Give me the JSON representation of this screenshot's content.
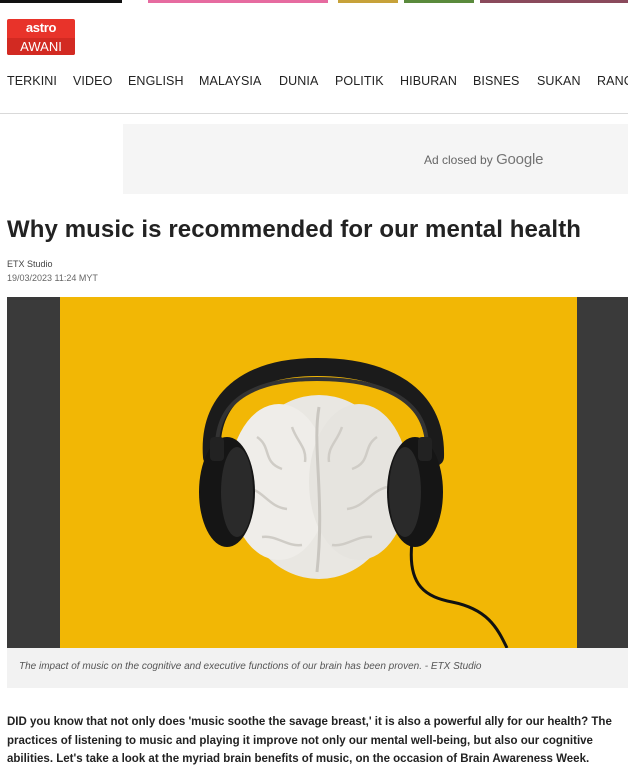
{
  "site": {
    "logo_top": "astro",
    "logo_bottom": "AWANI",
    "brand_color": "#e8332a"
  },
  "nav": {
    "items": [
      "TERKINI",
      "VIDEO",
      "ENGLISH",
      "MALAYSIA",
      "DUNIA",
      "POLITIK",
      "HIBURAN",
      "BISNES",
      "SUKAN",
      "RANC"
    ]
  },
  "ad": {
    "closed_text": "Ad closed by",
    "brand": "Google"
  },
  "article": {
    "title": "Why music is recommended for our mental health",
    "author": "ETX Studio",
    "date": "19/03/2023 11:24 MYT",
    "image_icon": "brain-with-headphones-image",
    "image_bg": "#f2b705",
    "caption": "The impact of music on the cognitive and executive functions of our brain has been proven. - ETX Studio",
    "lede": "DID you know that not only does 'music soothe the savage breast,' it is also a powerful ally for our health? The practices of listening to music and playing it improve not only our mental well-being, but also our cognitive abilities. Let's take a look at the myriad brain benefits of music, on the occasion of Brain Awareness Week."
  }
}
